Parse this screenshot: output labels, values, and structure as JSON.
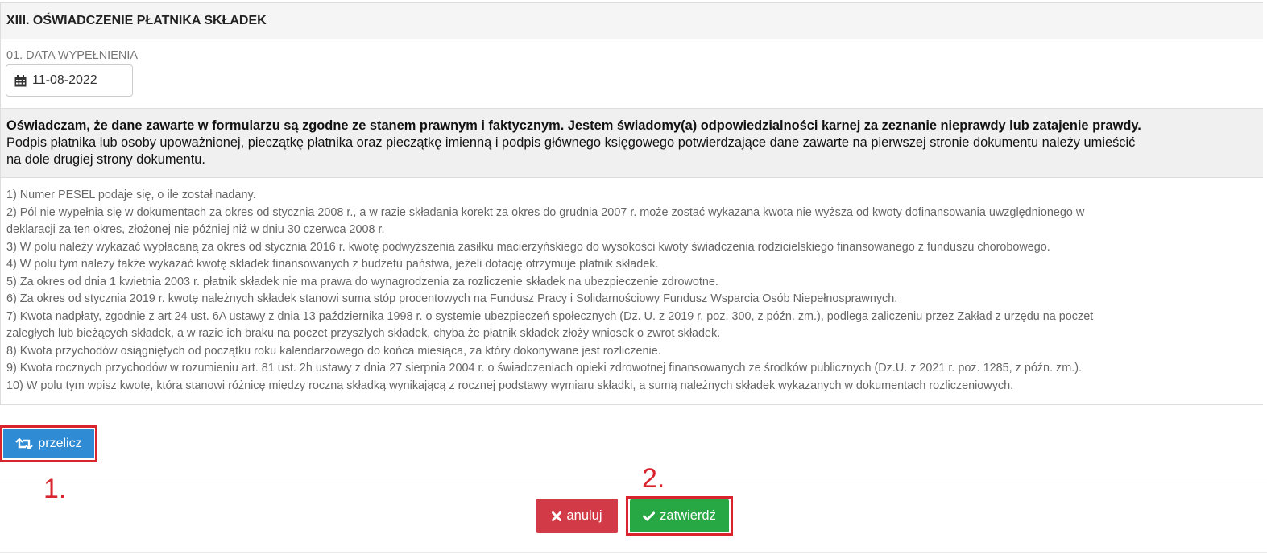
{
  "section": {
    "title": "XIII. OŚWIADCZENIE PŁATNIKA SKŁADEK",
    "date_label": "01. DATA WYPEŁNIENIA",
    "date_value": "11-08-2022",
    "statement_bold": "Oświadczam, że dane zawarte w formularzu są zgodne ze stanem prawnym i faktycznym. Jestem świadomy(a) odpowiedzialności karnej za zeznanie nieprawdy lub zatajenie prawdy.",
    "statement_line_1": "Podpis płatnika lub osoby upoważnionej, pieczątkę płatnika oraz pieczątkę imienną i podpis głównego księgowego potwierdzające dane zawarte na pierwszej stronie dokumentu należy umieścić",
    "statement_line_2": "na dole drugiej strony dokumentu."
  },
  "notes": [
    "1) Numer PESEL podaje się, o ile został nadany.",
    "2) Pól nie wypełnia się w dokumentach za okres od stycznia 2008 r., a w razie składania korekt za okres do grudnia 2007 r. może zostać wykazana kwota nie wyższa od kwoty dofinansowania uwzględnionego w",
    "deklaracji za ten okres, złożonej nie później niż w dniu 30 czerwca 2008 r.",
    "3) W polu należy wykazać wypłacaną za okres od stycznia 2016 r. kwotę podwyższenia zasiłku macierzyńskiego do wysokości kwoty świadczenia rodzicielskiego finansowanego z funduszu chorobowego.",
    "4) W polu tym należy także wykazać kwotę składek finansowanych z budżetu państwa, jeżeli dotację otrzymuje płatnik składek.",
    "5) Za okres od dnia 1 kwietnia 2003 r. płatnik składek nie ma prawa do wynagrodzenia za rozliczenie składek na ubezpieczenie zdrowotne.",
    "6) Za okres od stycznia 2019 r. kwotę należnych składek stanowi suma stóp procentowych na Fundusz Pracy i Solidarnościowy Fundusz Wsparcia Osób Niepełnosprawnych.",
    "7) Kwota nadpłaty, zgodnie z art 24 ust. 6A ustawy z dnia 13 października 1998 r. o systemie ubezpieczeń społecznych (Dz. U. z 2019 r. poz. 300, z późn. zm.), podlega zaliczeniu przez Zakład z urzędu na poczet",
    "zaległych lub bieżących składek, a w razie ich braku na poczet przyszłych składek, chyba że płatnik składek złoży wniosek o zwrot składek.",
    "8) Kwota przychodów osiągniętych od początku roku kalendarzowego do końca miesiąca, za który dokonywane jest rozliczenie.",
    "9) Kwota rocznych przychodów w rozumieniu art. 81 ust. 2h ustawy z dnia 27 sierpnia 2004 r. o świadczeniach opieki zdrowotnej finansowanych ze środków publicznych (Dz.U. z 2021 r. poz. 1285, z późn. zm.).",
    "10) W polu tym wpisz kwotę, która stanowi różnicę między roczną składką wynikającą z rocznej podstawy wymiaru składki, a sumą należnych składek wykazanych w dokumentach rozliczeniowych."
  ],
  "buttons": {
    "recalculate": "przelicz",
    "cancel": "anuluj",
    "confirm": "zatwierdź"
  },
  "annotations": {
    "marker_1": "1.",
    "marker_2": "2."
  },
  "icons": {
    "date": "calendar-icon",
    "recalculate": "retweet-icon",
    "cancel": "times-icon",
    "confirm": "check-icon"
  },
  "colors": {
    "recalculate_button": "#2f8bd3",
    "cancel_button": "#d33a47",
    "confirm_button": "#28a745",
    "highlight": "#d9232d"
  }
}
